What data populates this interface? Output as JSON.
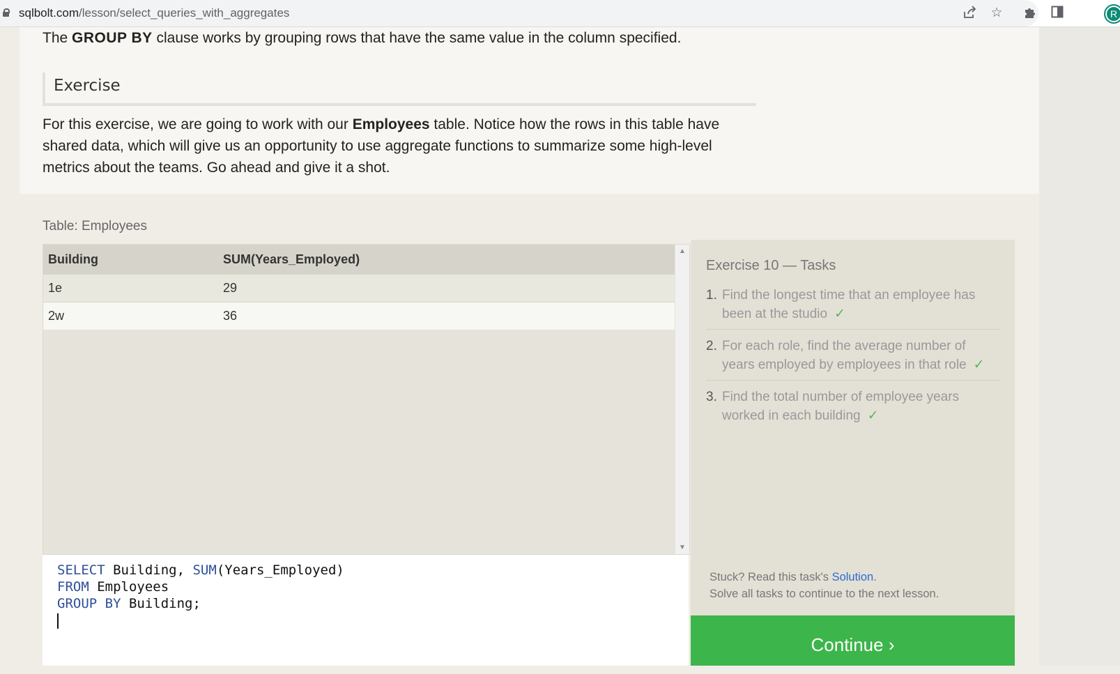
{
  "browser": {
    "url_host": "sqlbolt.com",
    "url_path": "/lesson/select_queries_with_aggregates",
    "avatar_letter": "R"
  },
  "lesson": {
    "intro_pre": "The ",
    "intro_bold": "GROUP BY",
    "intro_post": " clause works by grouping rows that have the same value in the column specified.",
    "exercise_heading": "Exercise",
    "para_pre": "For this exercise, we are going to work with our ",
    "para_bold": "Employees",
    "para_post": " table. Notice how the rows in this table have shared data, which will give us an opportunity to use aggregate functions to summarize some high-level metrics about the teams. Go ahead and give it a shot."
  },
  "results": {
    "table_label": "Table: Employees",
    "columns": [
      "Building",
      "SUM(Years_Employed)"
    ],
    "rows": [
      [
        "1e",
        "29"
      ],
      [
        "2w",
        "36"
      ]
    ]
  },
  "editor": {
    "line1_kw": "SELECT",
    "line1_rest": " Building, ",
    "line1_fn": "SUM",
    "line1_end": "(Years_Employed)",
    "line2_kw": "FROM",
    "line2_rest": " Employees",
    "line3_kw": "GROUP BY",
    "line3_rest": " Building;"
  },
  "tasks": {
    "title": "Exercise 10 — Tasks",
    "items": [
      {
        "num": "1.",
        "text": "Find the longest time that an employee has been at the studio",
        "check": "✓"
      },
      {
        "num": "2.",
        "text": "For each role, find the average number of years employed by employees in that role",
        "check": "✓"
      },
      {
        "num": "3.",
        "text": "Find the total number of employee years worked in each building",
        "check": "✓"
      }
    ],
    "stuck_pre": "Stuck? Read this task's ",
    "solution_link": "Solution",
    "stuck_post": ".",
    "solve_all": "Solve all tasks to continue to the next lesson.",
    "continue_label": "Continue ›"
  },
  "colors": {
    "continue_bg": "#3cb54a",
    "check": "#5db55a",
    "keyword": "#2e4f9a",
    "link": "#2e6bd1"
  }
}
